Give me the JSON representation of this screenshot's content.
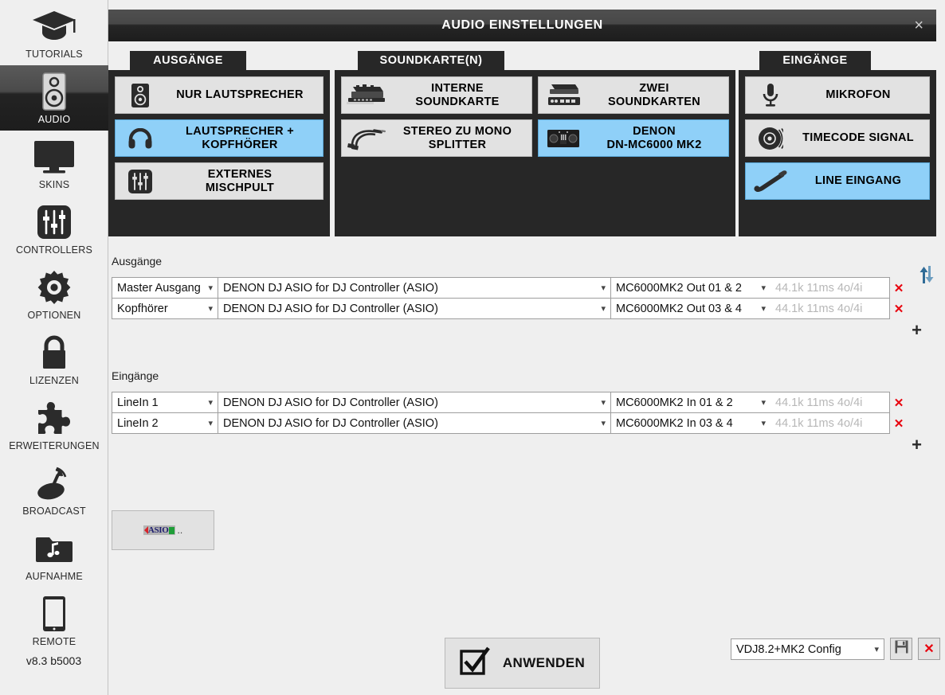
{
  "sidebar": {
    "items": [
      {
        "label": "TUTORIALS",
        "icon": "graduation-cap-icon",
        "active": false
      },
      {
        "label": "AUDIO",
        "icon": "speaker-icon",
        "active": true
      },
      {
        "label": "SKINS",
        "icon": "monitor-icon",
        "active": false
      },
      {
        "label": "CONTROLLERS",
        "icon": "sliders-icon",
        "active": false
      },
      {
        "label": "OPTIONEN",
        "icon": "gear-icon",
        "active": false
      },
      {
        "label": "LIZENZEN",
        "icon": "lock-icon",
        "active": false
      },
      {
        "label": "ERWEITERUNGEN",
        "icon": "puzzle-piece-icon",
        "active": false
      },
      {
        "label": "BROADCAST",
        "icon": "satellite-dish-icon",
        "active": false
      },
      {
        "label": "AUFNAHME",
        "icon": "music-folder-icon",
        "active": false
      },
      {
        "label": "REMOTE",
        "icon": "tablet-icon",
        "active": false
      }
    ],
    "version": "v8.3 b5003"
  },
  "dialog": {
    "title": "AUDIO EINSTELLUNGEN",
    "close_label": "×"
  },
  "panels": {
    "outputs": {
      "tab_label": "AUSGÄNGE",
      "options": [
        {
          "label": "NUR LAUTSPRECHER",
          "icon": "speaker-icon",
          "selected": false
        },
        {
          "label": "LAUTSPRECHER +\nKOPFHÖRER",
          "icon": "headphones-icon",
          "selected": true
        },
        {
          "label": "EXTERNES\nMISCHPULT",
          "icon": "mixer-sliders-icon",
          "selected": false
        }
      ]
    },
    "soundcards": {
      "tab_label": "SOUNDKARTE(N)",
      "options": [
        {
          "label": "INTERNE\nSOUNDKARTE",
          "icon": "soundcard-pci-icon",
          "selected": false
        },
        {
          "label": "ZWEI\nSOUNDKARTEN",
          "icon": "two-soundcards-icon",
          "selected": false
        },
        {
          "label": "STEREO ZU MONO\nSPLITTER",
          "icon": "splitter-cable-icon",
          "selected": false
        },
        {
          "label": "DENON\nDN-MC6000 MK2",
          "icon": "denon-controller-icon",
          "selected": true
        }
      ]
    },
    "inputs": {
      "tab_label": "EINGÄNGE",
      "options": [
        {
          "label": "MIKROFON",
          "icon": "microphone-icon",
          "selected": false
        },
        {
          "label": "TIMECODE SIGNAL",
          "icon": "vinyl-record-icon",
          "selected": false
        },
        {
          "label": "LINE EINGANG",
          "icon": "line-jack-cable-icon",
          "selected": true
        }
      ]
    }
  },
  "routing": {
    "outputs": {
      "section_label": "Ausgänge",
      "add_label": "+",
      "rows": [
        {
          "name": "Master Ausgang",
          "device": "DENON DJ ASIO for DJ Controller (ASIO)",
          "channel": "MC6000MK2 Out 01 & 2",
          "latency": "44.1k 11ms 4o/4i",
          "delete_label": "✕"
        },
        {
          "name": "Kopfhörer",
          "device": "DENON DJ ASIO for DJ Controller (ASIO)",
          "channel": "MC6000MK2 Out 03 & 4",
          "latency": "44.1k 11ms 4o/4i",
          "delete_label": "✕"
        }
      ]
    },
    "inputs": {
      "section_label": "Eingänge",
      "add_label": "+",
      "rows": [
        {
          "name": "LineIn 1",
          "device": "DENON DJ ASIO for DJ Controller (ASIO)",
          "channel": "MC6000MK2 In 01 & 2",
          "latency": "44.1k 11ms 4o/4i",
          "delete_label": "✕"
        },
        {
          "name": "LineIn 2",
          "device": "DENON DJ ASIO for DJ Controller (ASIO)",
          "channel": "MC6000MK2 In 03 & 4",
          "latency": "44.1k 11ms 4o/4i",
          "delete_label": "✕"
        }
      ]
    },
    "swap_icon": "swap-arrows-icon"
  },
  "asio_panel": {
    "mark_text": "ASIO",
    "dots": ".."
  },
  "bottom": {
    "apply_label": "ANWENDEN",
    "config_value": "VDJ8.2+MK2 Config",
    "save_icon": "floppy-disk-icon",
    "delete_icon": "red-x-icon",
    "delete_label": "✕"
  },
  "colors": {
    "accent_selected": "#8fd0f8",
    "panel_dark": "#272727",
    "background": "#efefef",
    "danger": "#e8000d"
  }
}
